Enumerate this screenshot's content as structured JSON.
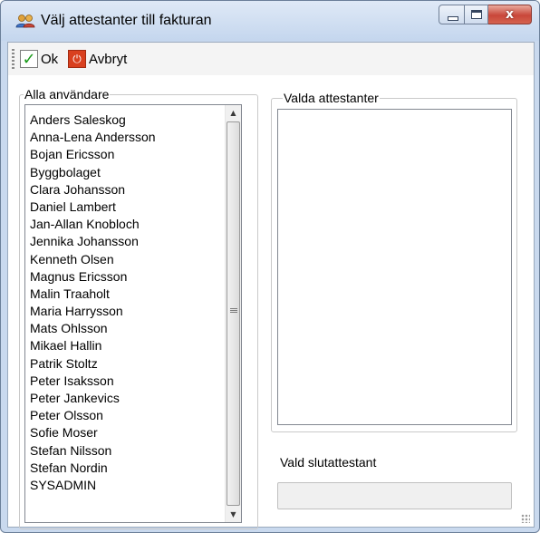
{
  "window": {
    "title": "Välj attestanter till fakturan",
    "icon": "users-icon",
    "close_glyph": "x"
  },
  "toolbar": {
    "ok_label": "Ok",
    "cancel_label": "Avbryt"
  },
  "all_users": {
    "label": "Alla användare",
    "items": [
      "Anders Saleskog",
      "Anna-Lena Andersson",
      "Bojan Ericsson",
      "Byggbolaget",
      "Clara Johansson",
      "Daniel Lambert",
      "Jan-Allan Knobloch",
      "Jennika Johansson",
      "Kenneth Olsen",
      "Magnus Ericsson",
      "Malin Traaholt",
      "Maria Harrysson",
      "Mats Ohlsson",
      "Mikael Hallin",
      "Patrik Stoltz",
      "Peter Isaksson",
      "Peter Jankevics",
      "Peter Olsson",
      "Sofie Moser",
      "Stefan Nilsson",
      "Stefan Nordin",
      "SYSADMIN"
    ]
  },
  "selected_attesters": {
    "label": "Valda attestanter",
    "items": []
  },
  "final_attester": {
    "label": "Vald slutattestant",
    "value": ""
  }
}
